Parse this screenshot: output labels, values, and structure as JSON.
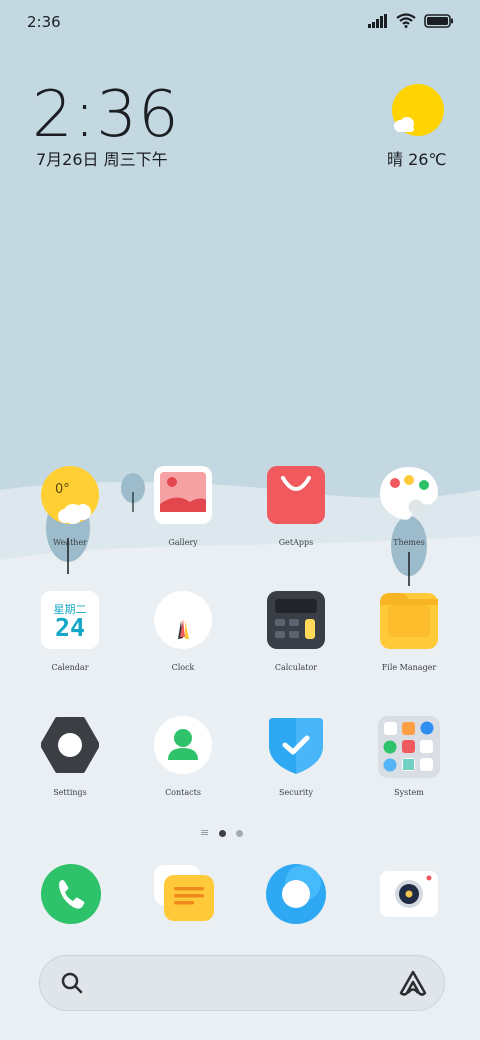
{
  "status_bar": {
    "time": "2:36"
  },
  "clock_widget": {
    "time": "2:36",
    "date": "7月26日 周三下午"
  },
  "weather_widget": {
    "text": "晴 26℃"
  },
  "apps": [
    {
      "label": "Weather",
      "icon": "weather-icon",
      "temp": "0°"
    },
    {
      "label": "Gallery",
      "icon": "gallery-icon"
    },
    {
      "label": "GetApps",
      "icon": "getapps-icon"
    },
    {
      "label": "Themes",
      "icon": "themes-icon"
    },
    {
      "label": "Calendar",
      "icon": "calendar-icon",
      "weekday": "星期二",
      "day": "24"
    },
    {
      "label": "Clock",
      "icon": "clock-icon"
    },
    {
      "label": "Calculator",
      "icon": "calculator-icon"
    },
    {
      "label": "File Manager",
      "icon": "file-manager-icon"
    },
    {
      "label": "Settings",
      "icon": "settings-icon"
    },
    {
      "label": "Contacts",
      "icon": "contacts-icon"
    },
    {
      "label": "Security",
      "icon": "security-icon"
    },
    {
      "label": "System",
      "icon": "system-folder-icon"
    }
  ],
  "dock": [
    {
      "icon": "phone-icon"
    },
    {
      "icon": "notes-icon"
    },
    {
      "icon": "browser-icon"
    },
    {
      "icon": "camera-icon"
    }
  ],
  "colors": {
    "sky": "#c4d8e1",
    "ground": "#e9eff3",
    "sun": "#ffd402",
    "accent_green": "#2ec26a",
    "accent_blue": "#2ea8f2"
  }
}
